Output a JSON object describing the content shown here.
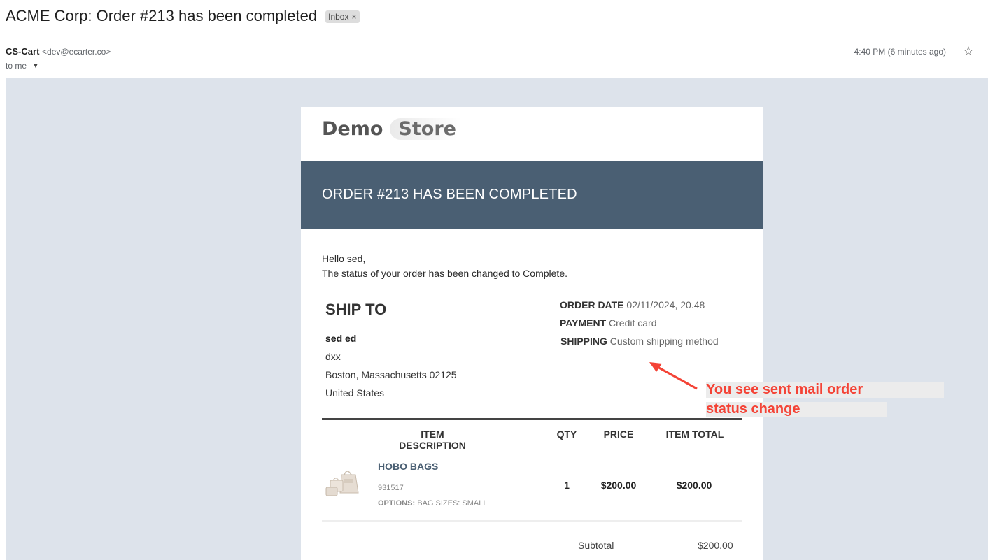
{
  "email": {
    "subject": "ACME Corp: Order #213 has been completed",
    "label": "Inbox",
    "sender_name": "CS-Cart",
    "sender_email": "<dev@ecarter.co>",
    "to": "to me",
    "time": "4:40 PM (6 minutes ago)"
  },
  "store": {
    "logo_part1": "Demo",
    "logo_part2": "Store",
    "banner_title": "ORDER #213 HAS BEEN COMPLETED",
    "greeting_line1": "Hello sed,",
    "greeting_line2": "The status of your order has been changed to Complete."
  },
  "ship_to": {
    "title": "SHIP TO",
    "name": "sed ed",
    "line1": "dxx",
    "line2": "Boston, Massachusetts 02125",
    "line3": "United States"
  },
  "order_meta": {
    "date_label": "ORDER DATE",
    "date_value": "02/11/2024, 20.48",
    "payment_label": "PAYMENT",
    "payment_value": "Credit card",
    "shipping_label": "SHIPPING",
    "shipping_value": "Custom shipping method"
  },
  "table": {
    "headers": {
      "description": "ITEM DESCRIPTION",
      "qty": "QTY",
      "price": "PRICE",
      "total": "ITEM TOTAL"
    },
    "items": [
      {
        "name": "HOBO BAGS",
        "code": "931517",
        "options_label": "OPTIONS:",
        "options_value": "BAG SIZES: SMALL",
        "qty": "1",
        "price": "$200.00",
        "total": "$200.00"
      }
    ],
    "subtotal_label": "Subtotal",
    "subtotal_value": "$200.00"
  },
  "annotation": {
    "line1": "You see sent mail order",
    "line2": "status change",
    "color": "#f44336"
  },
  "colors": {
    "banner": "#4a5f73",
    "page_background": "#dde3eb"
  }
}
